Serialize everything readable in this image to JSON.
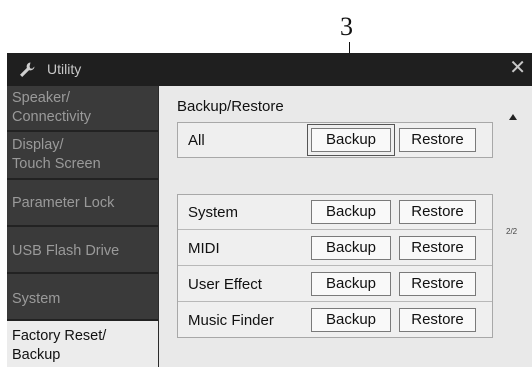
{
  "callout": {
    "number": "3"
  },
  "window": {
    "title": "Utility",
    "close_icon": "close-icon",
    "title_icon": "wrench-icon"
  },
  "sidebar": {
    "items": [
      {
        "line1": "Speaker/",
        "line2": "Connectivity",
        "selected": false
      },
      {
        "line1": "Display/",
        "line2": "Touch Screen",
        "selected": false
      },
      {
        "line1": "Parameter Lock",
        "line2": "",
        "selected": false
      },
      {
        "line1": "USB Flash Drive",
        "line2": "",
        "selected": false
      },
      {
        "line1": "System",
        "line2": "",
        "selected": false
      },
      {
        "line1": "Factory Reset/",
        "line2": "Backup",
        "selected": true
      }
    ]
  },
  "main": {
    "section_label": "Backup/Restore",
    "all_row": {
      "label": "All",
      "backup_label": "Backup",
      "restore_label": "Restore"
    },
    "rows": [
      {
        "label": "System",
        "backup_label": "Backup",
        "restore_label": "Restore"
      },
      {
        "label": "MIDI",
        "backup_label": "Backup",
        "restore_label": "Restore"
      },
      {
        "label": "User Effect",
        "backup_label": "Backup",
        "restore_label": "Restore"
      },
      {
        "label": "Music Finder",
        "backup_label": "Backup",
        "restore_label": "Restore"
      }
    ],
    "page_indicator": "2/2"
  }
}
